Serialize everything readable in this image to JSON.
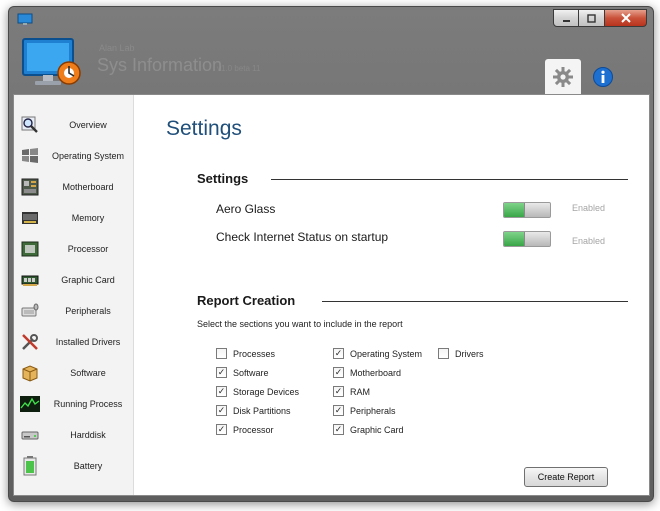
{
  "window": {
    "brand_small": "Alan Lab",
    "brand_big": "Sys Information",
    "brand_version": "v1.0 beta 11"
  },
  "header_tabs": [
    {
      "icon": "gear-icon",
      "active": true
    },
    {
      "icon": "info-icon",
      "active": false
    }
  ],
  "sidebar": {
    "items": [
      {
        "label": "Overview",
        "icon": "magnifier-icon"
      },
      {
        "label": "Operating System",
        "icon": "windows-logo-icon"
      },
      {
        "label": "Motherboard",
        "icon": "motherboard-icon"
      },
      {
        "label": "Memory",
        "icon": "memory-icon"
      },
      {
        "label": "Processor",
        "icon": "processor-icon"
      },
      {
        "label": "Graphic Card",
        "icon": "graphic-card-icon"
      },
      {
        "label": "Peripherals",
        "icon": "peripherals-icon"
      },
      {
        "label": "Installed Drivers",
        "icon": "tools-icon"
      },
      {
        "label": "Software",
        "icon": "software-box-icon"
      },
      {
        "label": "Running Process",
        "icon": "process-monitor-icon"
      },
      {
        "label": "Harddisk",
        "icon": "harddisk-icon"
      },
      {
        "label": "Battery",
        "icon": "battery-icon"
      }
    ]
  },
  "main": {
    "title": "Settings",
    "settings_section": {
      "heading": "Settings",
      "options": [
        {
          "label": "Aero Glass",
          "state": "Enabled",
          "on": true
        },
        {
          "label": "Check Internet Status on startup",
          "state": "Enabled",
          "on": true
        }
      ]
    },
    "report_section": {
      "heading": "Report Creation",
      "helper": "Select the sections you want to include in the report",
      "col1": [
        {
          "label": "Processes",
          "checked": false
        },
        {
          "label": "Software",
          "checked": true
        },
        {
          "label": "Storage Devices",
          "checked": true
        },
        {
          "label": "Disk Partitions",
          "checked": true
        },
        {
          "label": "Processor",
          "checked": true
        }
      ],
      "col2": [
        {
          "label": "Operating System",
          "checked": true
        },
        {
          "label": "Motherboard",
          "checked": true
        },
        {
          "label": "RAM",
          "checked": true
        },
        {
          "label": "Peripherals",
          "checked": true
        },
        {
          "label": "Graphic Card",
          "checked": true
        }
      ],
      "col3": [
        {
          "label": "Drivers",
          "checked": false
        }
      ],
      "button": "Create Report"
    }
  }
}
